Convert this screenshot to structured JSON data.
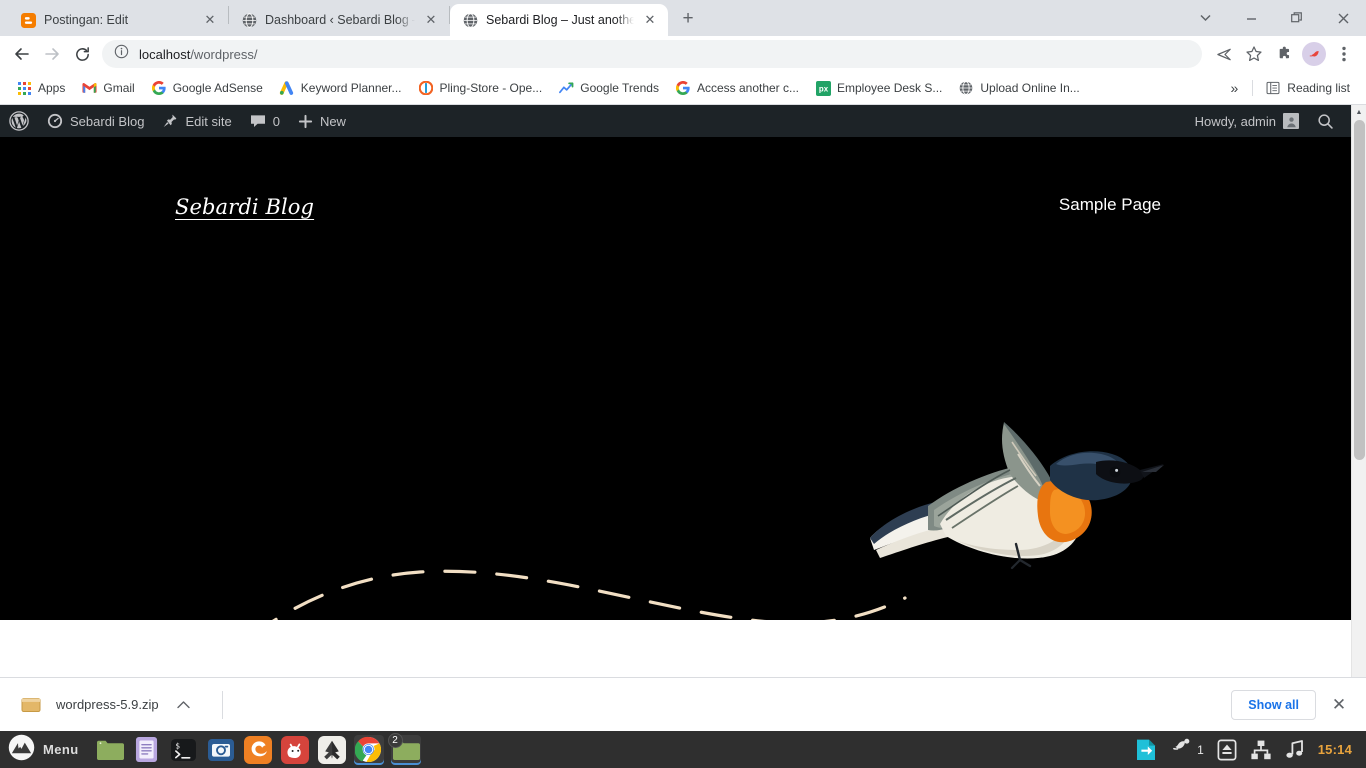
{
  "browser": {
    "tabs": [
      {
        "title": "Postingan: Edit",
        "favicon": "blogger-icon",
        "active": false
      },
      {
        "title": "Dashboard ‹ Sebardi Blog — W",
        "favicon": "globe-icon",
        "active": false
      },
      {
        "title": "Sebardi Blog – Just another W",
        "favicon": "globe-icon",
        "active": true
      }
    ],
    "new_tab_label": "+",
    "window_controls": {
      "tab_search": "∨",
      "minimize": "—",
      "restore": "❐",
      "close": "✕"
    },
    "nav": {
      "back": "back-icon",
      "forward": "forward-icon",
      "reload": "reload-icon"
    },
    "address": {
      "prefix": "localhost",
      "suffix": "/wordpress/",
      "full": "localhost/wordpress/",
      "info_icon": "info-circle-icon"
    },
    "toolbar_icons": [
      "share-icon",
      "bookmark-star-icon",
      "extensions-puzzle-icon",
      "profile-avatar-icon",
      "three-dot-menu-icon"
    ],
    "bookmarks": [
      {
        "label": "Apps",
        "icon": "apps-grid-icon"
      },
      {
        "label": "Gmail",
        "icon": "gmail-icon"
      },
      {
        "label": "Google AdSense",
        "icon": "google-g-icon"
      },
      {
        "label": "Keyword Planner...",
        "icon": "google-ads-icon"
      },
      {
        "label": "Pling-Store - Ope...",
        "icon": "pling-icon"
      },
      {
        "label": "Google Trends",
        "icon": "trends-icon"
      },
      {
        "label": "Access another c...",
        "icon": "google-g-icon"
      },
      {
        "label": "Employee Desk S...",
        "icon": "px-green-icon"
      },
      {
        "label": "Upload Online In...",
        "icon": "globe-icon"
      }
    ],
    "bookmarks_overflow": "»",
    "reading_list": {
      "label": "Reading list",
      "icon": "reading-list-icon"
    }
  },
  "wp_admin_bar": {
    "logo": "wordpress-logo-icon",
    "site_name": "Sebardi Blog",
    "site_icon": "dashboard-gauge-icon",
    "edit_site": "Edit site",
    "edit_site_icon": "pushpin-icon",
    "comments_count": "0",
    "comments_icon": "comment-bubble-icon",
    "new_label": "New",
    "new_icon": "plus-icon",
    "howdy": "Howdy, admin",
    "avatar_icon": "user-avatar-icon",
    "search_icon": "search-icon"
  },
  "site": {
    "title": "Sebardi Blog",
    "nav": [
      {
        "label": "Sample Page"
      }
    ],
    "hero": {
      "bird_alt": "bird-illustration",
      "path_color": "#f2dfc4",
      "background": "#000000"
    }
  },
  "downloads": {
    "file_name": "wordpress-5.9.zip",
    "file_icon": "zip-file-icon",
    "expand_icon": "chevron-up-icon",
    "show_all_label": "Show all",
    "close_label": "✕"
  },
  "taskbar": {
    "menu_label": "Menu",
    "menu_icon": "linux-mint-menu-icon",
    "apps": [
      {
        "name": "file-manager-icon",
        "running": false,
        "badge": ""
      },
      {
        "name": "text-editor-icon",
        "running": false,
        "badge": ""
      },
      {
        "name": "terminal-icon",
        "running": false,
        "badge": ""
      },
      {
        "name": "screenshot-camera-icon",
        "running": false,
        "badge": ""
      },
      {
        "name": "firefox-icon",
        "running": false,
        "badge": ""
      },
      {
        "name": "gimp-icon",
        "running": false,
        "badge": ""
      },
      {
        "name": "inkscape-icon",
        "running": false,
        "badge": ""
      },
      {
        "name": "google-chrome-icon",
        "running": true,
        "badge": ""
      },
      {
        "name": "file-manager-window-icon",
        "running": true,
        "badge": "2"
      }
    ],
    "tray": {
      "update_icon": "update-manager-icon",
      "notifications_icon": "notification-bell-icon",
      "notifications_count": "1",
      "eject_icon": "eject-media-icon",
      "network_icon": "network-icon",
      "sound_icon": "music-note-icon",
      "clock": "15:14"
    }
  }
}
